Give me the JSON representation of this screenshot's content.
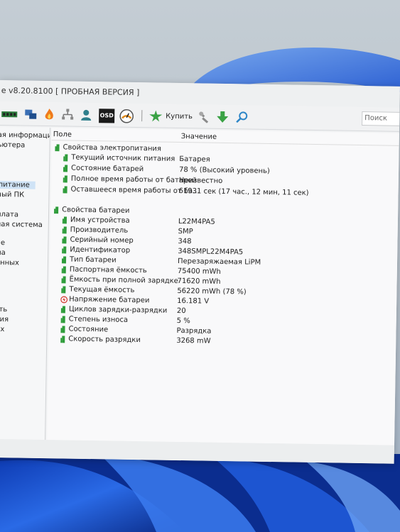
{
  "window": {
    "title": "e v8.20.8100  [ ПРОБНАЯ ВЕРСИЯ ]"
  },
  "toolbar": {
    "icons": [
      "memory-icon",
      "network-icon",
      "fire-icon",
      "network-tree-icon",
      "user-icon",
      "osd-icon",
      "gauge-icon",
      "buy-icon",
      "tools-icon",
      "download-icon",
      "search-icon"
    ],
    "osd_label": "OSD",
    "buy_label": "Купить",
    "search_placeholder": "Поиск"
  },
  "sidebar": {
    "items": [
      "ая информация",
      "ьютера",
      "питание",
      "ный ПК",
      "плата",
      "ная система",
      "ие",
      "ма",
      "анных",
      "ь",
      "сть",
      "ция",
      "ых"
    ],
    "selected_index": 2
  },
  "table": {
    "col_field": "Поле",
    "col_value": "Значение",
    "groups": [
      {
        "label": "Свойства электропитания",
        "rows": [
          {
            "field": "Текущий источник питания",
            "value": "Батарея"
          },
          {
            "field": "Состояние батарей",
            "value": "78 % (Высокий уровень)"
          },
          {
            "field": "Полное время работы от батарей",
            "value": "Неизвестно"
          },
          {
            "field": "Оставшееся время работы от ба...",
            "value": "61931 сек (17 час., 12 мин, 11 сек)"
          }
        ]
      },
      {
        "label": "Свойства батареи",
        "rows": [
          {
            "field": "Имя устройства",
            "value": "L22M4PA5"
          },
          {
            "field": "Производитель",
            "value": "SMP"
          },
          {
            "field": "Серийный номер",
            "value": "348"
          },
          {
            "field": "Идентификатор",
            "value": "348SMPL22M4PA5"
          },
          {
            "field": "Тип батареи",
            "value": "Перезаряжаемая LiPM"
          },
          {
            "field": "Паспортная ёмкость",
            "value": "75400 mWh"
          },
          {
            "field": "Ёмкость при полной зарядке",
            "value": "71620 mWh"
          },
          {
            "field": "Текущая ёмкость",
            "value": "56220 mWh  (78 %)"
          },
          {
            "field": "Напряжение батареи",
            "value": "16.181 V"
          },
          {
            "field": "Циклов зарядки-разрядки",
            "value": "20"
          },
          {
            "field": "Степень износа",
            "value": "5 %"
          },
          {
            "field": "Состояние",
            "value": "Разрядка"
          },
          {
            "field": "Скорость разрядки",
            "value": "3268 mW"
          }
        ]
      }
    ]
  },
  "colors": {
    "wallpaper_blue": "#1e5bd6",
    "battery_green": "#2e9c3a",
    "voltage_red": "#d0342c",
    "selection": "#cfe3f6"
  }
}
